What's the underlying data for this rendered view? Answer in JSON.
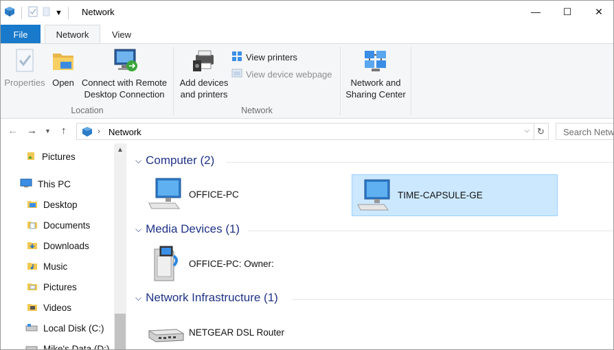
{
  "window": {
    "title": "Network",
    "minimize_glyph": "—",
    "maximize_glyph": "☐",
    "close_glyph": "✕"
  },
  "ribbon_tabs": [
    {
      "label": "File"
    },
    {
      "label": "Network"
    },
    {
      "label": "View"
    }
  ],
  "ribbon": {
    "location_group": {
      "label": "Location",
      "buttons": [
        {
          "label": "Properties",
          "icon": "properties-icon",
          "enabled": false
        },
        {
          "label": "Open",
          "icon": "open-folder-icon",
          "enabled": true
        },
        {
          "label": "Connect with Remote Desktop Connection",
          "line1": "Connect with Remote",
          "line2": "Desktop Connection",
          "icon": "remote-desktop-icon",
          "enabled": true
        }
      ]
    },
    "network_group": {
      "label": "Network",
      "add_devices": {
        "line1": "Add devices",
        "line2": "and printers",
        "icon": "devices-printers-icon"
      },
      "view_printers": {
        "label": "View printers",
        "icon": "printers-icon"
      },
      "view_device_webpage": {
        "label": "View device webpage",
        "icon": "device-webpage-icon",
        "enabled": false
      }
    },
    "sharing": {
      "line1": "Network and",
      "line2": "Sharing Center",
      "icon": "network-sharing-icon"
    }
  },
  "address": {
    "path": [
      "Network"
    ],
    "search_placeholder": "Search Network"
  },
  "sidebar": {
    "items": [
      {
        "label": "Pictures",
        "icon": "pictures-icon"
      },
      {
        "label": "This PC",
        "icon": "this-pc-icon"
      },
      {
        "label": "Desktop",
        "icon": "desktop-folder-icon"
      },
      {
        "label": "Documents",
        "icon": "documents-folder-icon"
      },
      {
        "label": "Downloads",
        "icon": "downloads-folder-icon"
      },
      {
        "label": "Music",
        "icon": "music-folder-icon"
      },
      {
        "label": "Pictures",
        "icon": "pictures-folder-icon"
      },
      {
        "label": "Videos",
        "icon": "videos-folder-icon"
      },
      {
        "label": "Local Disk (C:)",
        "icon": "local-disk-icon"
      },
      {
        "label": "Mike's Data (D:)",
        "icon": "drive-icon"
      }
    ]
  },
  "groups": [
    {
      "label": "Computer (2)",
      "items": [
        {
          "label": "OFFICE-PC",
          "icon": "computer-icon",
          "selected": false
        },
        {
          "label": "TIME-CAPSULE-GE",
          "icon": "computer-icon",
          "selected": true
        }
      ]
    },
    {
      "label": "Media Devices (1)",
      "items": [
        {
          "label": "OFFICE-PC: Owner:",
          "icon": "media-device-icon",
          "selected": false
        }
      ]
    },
    {
      "label": "Network Infrastructure (1)",
      "items": [
        {
          "label": "NETGEAR DSL Router",
          "icon": "router-icon",
          "selected": false
        }
      ]
    }
  ],
  "colors": {
    "file_tab": "#1979ca",
    "group_header": "#1e3287",
    "selection_bg": "#cce8ff",
    "selection_border": "#99d1ff"
  }
}
